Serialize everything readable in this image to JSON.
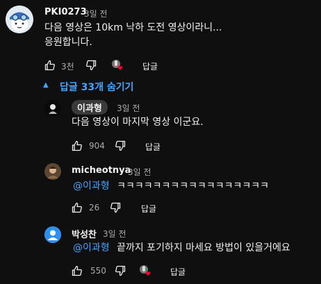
{
  "comment": {
    "author": "PKI0273",
    "time": "3일 전",
    "text_line1": "다음 영상은 10km 낙하 도전 영상이라니...",
    "text_line2": "응원합니다.",
    "likes": "3천",
    "reply_label": "답글"
  },
  "replies_toggle": {
    "arrow": "▲",
    "label": "답글 33개 숨기기"
  },
  "replies": [
    {
      "author": "이과형",
      "time": "3일 전",
      "mention": "",
      "text": "다음 영상이 마지막 영상 이군요.",
      "likes": "904",
      "reply_label": "답글"
    },
    {
      "author": "micheotnya",
      "time": "3일 전",
      "mention": "@이과형",
      "text": "ㅋㅋㅋㅋㅋㅋㅋㅋㅋㅋㅋㅋㅋㅋㅋㅋㅋ",
      "likes": "26",
      "reply_label": "답글"
    },
    {
      "author": "박성찬",
      "time": "3일 전",
      "mention": "@이과형",
      "text": "끝까지 포기하지 마세요 방법이 있을거에요",
      "likes": "550",
      "reply_label": "답글"
    }
  ],
  "colors": {
    "background": "#0f0f0f",
    "link": "#3ea6ff",
    "heart": "#ff0033",
    "muted": "#aaaaaa"
  }
}
